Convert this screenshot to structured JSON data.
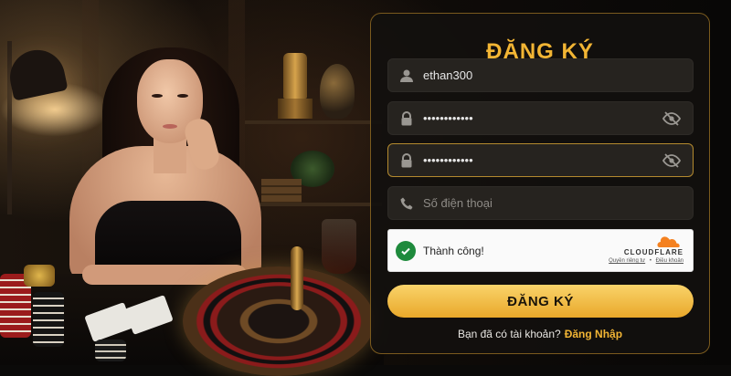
{
  "form": {
    "title": "ĐĂNG KÝ",
    "username": {
      "value": "ethan300",
      "icon": "user-icon"
    },
    "password": {
      "value": "••••••••••••",
      "icon": "lock-icon",
      "toggle_icon": "eye-off-icon"
    },
    "confirm_password": {
      "value": "••••••••••••",
      "icon": "lock-icon",
      "toggle_icon": "eye-off-icon"
    },
    "phone": {
      "placeholder": "Số điện thoại",
      "icon": "phone-icon"
    },
    "captcha": {
      "status": "Thành công!",
      "brand": "CLOUDFLARE",
      "privacy_link": "Quyền riêng tư",
      "separator": "•",
      "terms_link": "Điều khoản"
    },
    "submit_label": "ĐĂNG KÝ",
    "footer_text": "Bạn đã có tài khoản?",
    "login_link": "Đăng Nhập"
  },
  "colors": {
    "accent": "#f2b534",
    "panel_border": "#7a5a1e",
    "success": "#1e8a3c",
    "cloudflare_orange": "#f48120"
  }
}
